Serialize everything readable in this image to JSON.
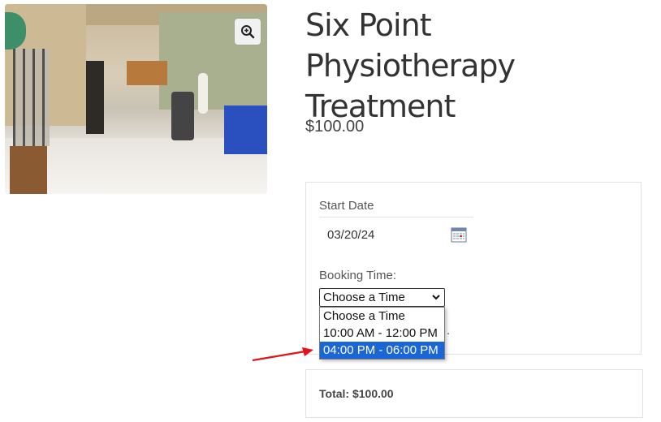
{
  "product": {
    "title": "Six Point Physiotherapy Treatment",
    "price": "$100.00",
    "image_icon": "zoom-in-icon"
  },
  "booking": {
    "start_date_label": "Start Date",
    "start_date_value": "03/20/24",
    "calendar_icon": "calendar-icon",
    "booking_time_label": "Booking Time:",
    "select_value": "Choose a Time",
    "options": [
      "Choose a Time",
      "10:00 AM - 12:00 PM",
      "04:00 PM - 06:00 PM"
    ],
    "highlighted_option_index": 2
  },
  "total": {
    "text": "Total: $100.00"
  },
  "colors": {
    "highlight": "#1a66d6",
    "arrow": "#e0141a"
  }
}
